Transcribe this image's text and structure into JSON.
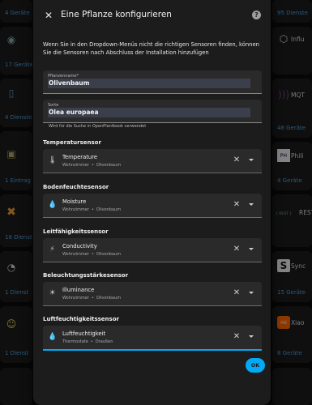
{
  "background": {
    "left_cards": [
      {
        "footer": "4 Geräte"
      },
      {
        "footer": "17 Geräte"
      },
      {
        "footer": "4 Dienste"
      },
      {
        "footer": "1 Eintrag"
      },
      {
        "footer": "18 Dienste"
      },
      {
        "footer": "1 Dienst"
      },
      {
        "footer": "1 Dienst"
      }
    ],
    "right_cards": [
      {
        "name": "",
        "footer": "95 Dienste"
      },
      {
        "name": "Influ",
        "footer": ""
      },
      {
        "name": "MQT",
        "footer": "48 Geräte"
      },
      {
        "name": "Phili",
        "footer": "4 Geräte"
      },
      {
        "name": "REST",
        "badge": "{ REST }",
        "footer": ""
      },
      {
        "name": "Sync",
        "footer": "15 Geräte"
      },
      {
        "name": "Xiao",
        "footer": "8 Geräte"
      }
    ]
  },
  "dialog": {
    "title": "Eine Pflanze konfigurieren",
    "intro": "Wenn Sie in den Dropdown-Menüs nicht die richtigen Sensoren finden, können Sie die Sensoren nach Abschluss der Installation hinzufügen",
    "plant_name": {
      "label": "Pflanzenname*",
      "value": "Olivenbaum"
    },
    "species": {
      "label": "Sorte",
      "value": "Olea europaea",
      "helper": "Wird für die Suche in OpenPlantbook verwendet"
    },
    "sections": [
      {
        "title": "Temperatursensor",
        "entity": "Temperature",
        "area": "Wohnzimmer",
        "device": "Olivenbaum",
        "icon": "thermometer-icon",
        "glyph": "🌡"
      },
      {
        "title": "Bodenfeuchtesensor",
        "entity": "Moisture",
        "area": "Wohnzimmer",
        "device": "Olivenbaum",
        "icon": "water-drop-icon",
        "glyph": "💧"
      },
      {
        "title": "Leitfähigkeitssensor",
        "entity": "Conductivity",
        "area": "Wohnzimmer",
        "device": "Olivenbaum",
        "icon": "conductivity-icon",
        "glyph": "⚡"
      },
      {
        "title": "Beleuchtungsstärkesensor",
        "entity": "Illuminance",
        "area": "Wohnzimmer",
        "device": "Olivenbaum",
        "icon": "sun-icon",
        "glyph": "☀"
      },
      {
        "title": "Luftfeuchtigkeitssensor",
        "entity": "Luftfeuchtigkeit",
        "area": "Thermostate",
        "device": "Draußen",
        "icon": "humidity-icon",
        "glyph": "💧"
      }
    ],
    "ok_label": "OK"
  },
  "colors": {
    "accent": "#03a9f4",
    "dialog_bg": "#1c1c1c",
    "field_bg": "#2a2a2a",
    "link": "#4fa3e0"
  }
}
